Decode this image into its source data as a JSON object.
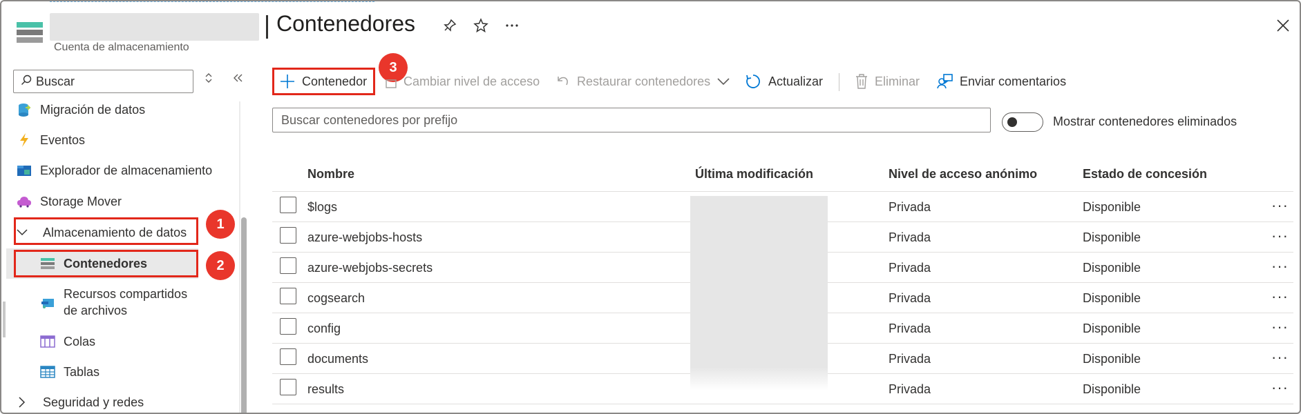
{
  "header": {
    "account_subtitle": "Cuenta de almacenamiento",
    "title": "Contenedores",
    "pin_icon": "pin-icon",
    "star_icon": "star-icon",
    "more_icon": "ellipsis-icon",
    "close_icon": "close-icon"
  },
  "sidebar": {
    "search_placeholder": "Buscar",
    "items": [
      {
        "label": "Migración de datos",
        "icon": "data-migration-icon"
      },
      {
        "label": "Eventos",
        "icon": "lightning-icon"
      },
      {
        "label": "Explorador de almacenamiento",
        "icon": "storage-explorer-icon"
      },
      {
        "label": "Storage Mover",
        "icon": "cloud-icon"
      },
      {
        "label": "Almacenamiento de datos",
        "icon": "chevron-down-icon"
      },
      {
        "label": "Contenedores",
        "icon": "containers-icon"
      },
      {
        "label_line1": "Recursos compartidos",
        "label_line2": "de archivos",
        "icon": "file-shares-icon"
      },
      {
        "label": "Colas",
        "icon": "queues-icon"
      },
      {
        "label": "Tablas",
        "icon": "tables-icon"
      },
      {
        "label": "Seguridad y redes",
        "icon": "chevron-right-icon"
      }
    ]
  },
  "callouts": [
    "1",
    "2",
    "3"
  ],
  "toolbar": {
    "add_container": "Contenedor",
    "change_access": "Cambiar nivel de acceso",
    "restore": "Restaurar contenedores",
    "refresh": "Actualizar",
    "delete": "Eliminar",
    "feedback": "Enviar comentarios"
  },
  "filter": {
    "placeholder": "Buscar contenedores por prefijo",
    "toggle_label": "Mostrar contenedores eliminados",
    "toggle_on": false
  },
  "table": {
    "columns": [
      "Nombre",
      "Última modificación",
      "Nivel de acceso anónimo",
      "Estado de concesión"
    ],
    "rows": [
      {
        "name": "$logs",
        "access": "Privada",
        "lease": "Disponible"
      },
      {
        "name": "azure-webjobs-hosts",
        "access": "Privada",
        "lease": "Disponible"
      },
      {
        "name": "azure-webjobs-secrets",
        "access": "Privada",
        "lease": "Disponible"
      },
      {
        "name": "cogsearch",
        "access": "Privada",
        "lease": "Disponible"
      },
      {
        "name": "config",
        "access": "Privada",
        "lease": "Disponible"
      },
      {
        "name": "documents",
        "access": "Privada",
        "lease": "Disponible"
      },
      {
        "name": "results",
        "access": "Privada",
        "lease": "Disponible"
      }
    ]
  },
  "colors": {
    "highlight": "#e2271a",
    "badge": "#e9362b",
    "accent": "#0078d4"
  }
}
